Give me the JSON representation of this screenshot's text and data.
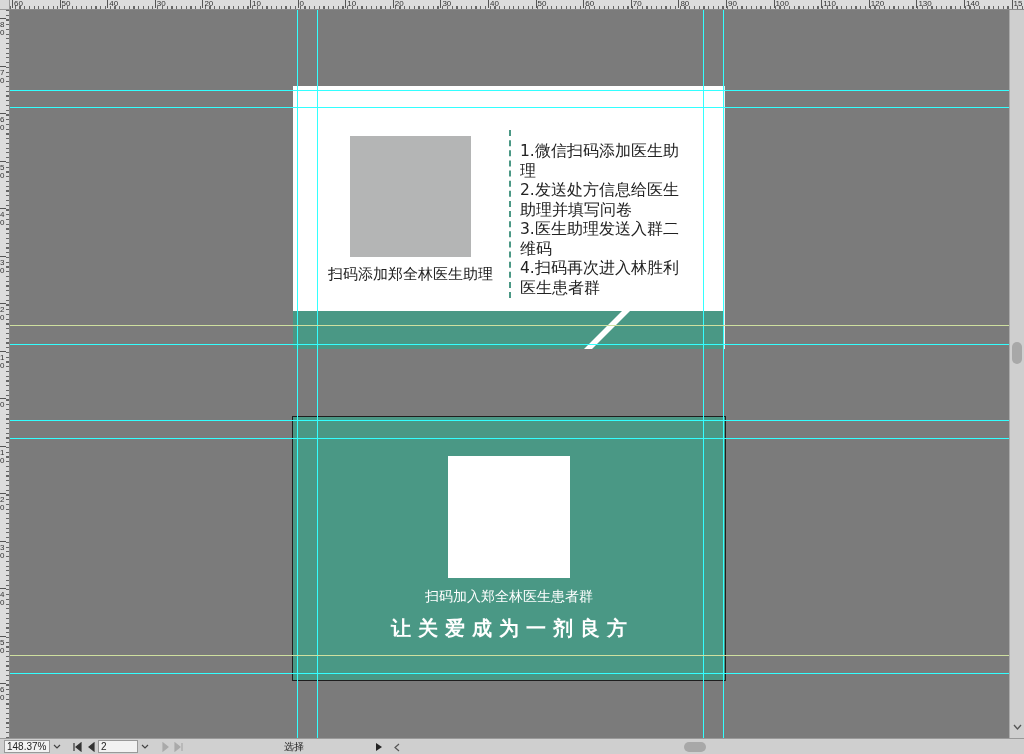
{
  "rulers": {
    "horizontal": [
      "60",
      "50",
      "40",
      "30",
      "20",
      "10",
      "0",
      "10",
      "20",
      "30",
      "40",
      "50",
      "60",
      "70",
      "80",
      "90",
      "100",
      "110",
      "120",
      "130",
      "140",
      "15"
    ],
    "vertical": [
      "80",
      "70",
      "60",
      "50",
      "40",
      "30",
      "20",
      "10",
      "0",
      "10",
      "20",
      "30",
      "40",
      "50",
      "60"
    ]
  },
  "front_card": {
    "qr_caption": "扫码添加郑全林医生助理",
    "steps": [
      "1.微信扫码添加医生助理",
      "2.发送处方信息给医生助理并填写问卷",
      "3.医生助理发送入群二维码",
      "4.扫码再次进入林胜利医生患者群"
    ]
  },
  "back_card": {
    "qr_caption": "扫码加入郑全林医生患者群",
    "slogan": "让关爱成为一剂良方"
  },
  "status_bar": {
    "zoom": "148.37%",
    "page": "2",
    "nav": [
      {
        "kind": "first",
        "disabled": false
      },
      {
        "kind": "prev",
        "disabled": false
      },
      {
        "kind": "next",
        "disabled": true
      },
      {
        "kind": "last",
        "disabled": true
      }
    ],
    "tool": "选择"
  }
}
